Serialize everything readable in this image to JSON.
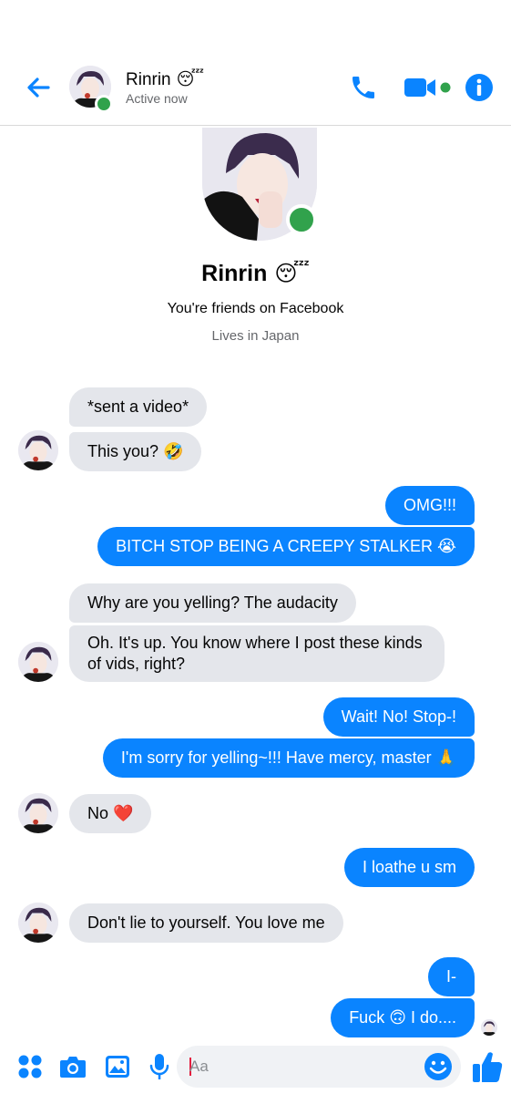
{
  "header": {
    "contact_name": "Rinrin",
    "contact_emoji": "😴",
    "status": "Active now",
    "icons": [
      "back-arrow-icon",
      "phone-icon",
      "video-camera-icon",
      "info-icon"
    ]
  },
  "intro": {
    "name": "Rinrin",
    "emoji": "😴",
    "friends_line": "You're friends on Facebook",
    "lives_line": "Lives in Japan"
  },
  "messages": [
    {
      "from": "them",
      "text": "*sent a video*"
    },
    {
      "from": "them",
      "text": "This you? 🤣"
    },
    {
      "from": "me",
      "text": "OMG!!!"
    },
    {
      "from": "me",
      "text": "BITCH STOP BEING A CREEPY STALKER 😭"
    },
    {
      "from": "them",
      "text": "Why are you yelling? The audacity"
    },
    {
      "from": "them",
      "text": "Oh. It's up. You know where I post these kinds of vids, right?"
    },
    {
      "from": "me",
      "text": "Wait! No! Stop-!"
    },
    {
      "from": "me",
      "text": "I'm sorry for yelling~!!! Have mercy, master 🙏"
    },
    {
      "from": "them",
      "text": "No ❤️"
    },
    {
      "from": "me",
      "text": "I loathe u sm"
    },
    {
      "from": "them",
      "text": "Don't lie to yourself. You love me"
    },
    {
      "from": "me",
      "text": "I-"
    },
    {
      "from": "me",
      "text": "Fuck 🙃 I do...."
    }
  ],
  "composer": {
    "placeholder": "Aa",
    "icons": [
      "apps-icon",
      "camera-icon",
      "gallery-icon",
      "microphone-icon",
      "emoji-icon",
      "thumbs-up-icon"
    ]
  },
  "colors": {
    "accent": "#0a84ff",
    "incoming_bubble": "#e4e6eb",
    "online": "#31a24c"
  }
}
